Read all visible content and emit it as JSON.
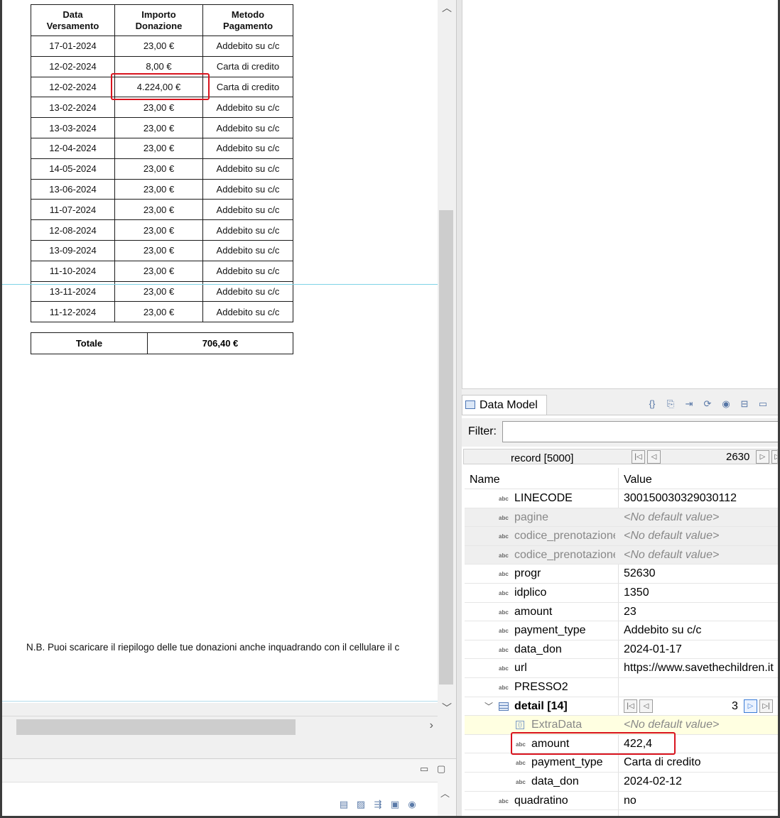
{
  "report": {
    "headers": [
      [
        "Data",
        "Versamento"
      ],
      [
        "Importo",
        "Donazione"
      ],
      [
        "Metodo",
        "Pagamento"
      ]
    ],
    "rows": [
      [
        "17-01-2024",
        "23,00 €",
        "Addebito su c/c"
      ],
      [
        "12-02-2024",
        "8,00 €",
        "Carta di credito"
      ],
      [
        "12-02-2024",
        "4.224,00 €",
        "Carta di credito"
      ],
      [
        "13-02-2024",
        "23,00 €",
        "Addebito su c/c"
      ],
      [
        "13-03-2024",
        "23,00 €",
        "Addebito su c/c"
      ],
      [
        "12-04-2024",
        "23,00 €",
        "Addebito su c/c"
      ],
      [
        "14-05-2024",
        "23,00 €",
        "Addebito su c/c"
      ],
      [
        "13-06-2024",
        "23,00 €",
        "Addebito su c/c"
      ],
      [
        "11-07-2024",
        "23,00 €",
        "Addebito su c/c"
      ],
      [
        "12-08-2024",
        "23,00 €",
        "Addebito su c/c"
      ],
      [
        "13-09-2024",
        "23,00 €",
        "Addebito su c/c"
      ],
      [
        "11-10-2024",
        "23,00 €",
        "Addebito su c/c"
      ],
      [
        "13-11-2024",
        "23,00 €",
        "Addebito su c/c"
      ],
      [
        "11-12-2024",
        "23,00 €",
        "Addebito su c/c"
      ]
    ],
    "total_label": "Totale",
    "total_value": "706,40 €",
    "note": "N.B. Puoi scaricare il riepilogo delle tue donazioni anche inquadrando con il cellulare il c",
    "highlight_color": "#d9141e"
  },
  "data_model": {
    "tab_label": "Data Model",
    "filter_label": "Filter:",
    "filter_value": "",
    "record_label": "record [5000]",
    "record_position": "2630",
    "col_name": "Name",
    "col_value": "Value",
    "rows": [
      {
        "name": "LINECODE",
        "value": "300150030329030112",
        "style": ""
      },
      {
        "name": "pagine",
        "value": "<No default value>",
        "style": "grey"
      },
      {
        "name": "codice_prenotazione",
        "value": "<No default value>",
        "style": "grey"
      },
      {
        "name": "codice_prenotazione",
        "value": "<No default value>",
        "style": "grey"
      },
      {
        "name": "progr",
        "value": "52630",
        "style": ""
      },
      {
        "name": "idplico",
        "value": "1350",
        "style": ""
      },
      {
        "name": "amount",
        "value": "23",
        "style": ""
      },
      {
        "name": "payment_type",
        "value": "Addebito su c/c",
        "style": ""
      },
      {
        "name": "data_don",
        "value": "2024-01-17",
        "style": ""
      },
      {
        "name": "url",
        "value": "https://www.savethechildren.it",
        "style": ""
      },
      {
        "name": "PRESSO2",
        "value": "",
        "style": ""
      }
    ],
    "detail": {
      "name": "detail [14]",
      "position": "3"
    },
    "detail_rows": [
      {
        "name": "ExtraData",
        "value": "<No default value>",
        "style": "yellow"
      },
      {
        "name": "amount",
        "value": "422,4",
        "style": ""
      },
      {
        "name": "payment_type",
        "value": "Carta di credito",
        "style": ""
      },
      {
        "name": "data_don",
        "value": "2024-02-12",
        "style": ""
      }
    ],
    "after_rows": [
      {
        "name": "quadratino",
        "value": "no",
        "style": ""
      }
    ]
  }
}
